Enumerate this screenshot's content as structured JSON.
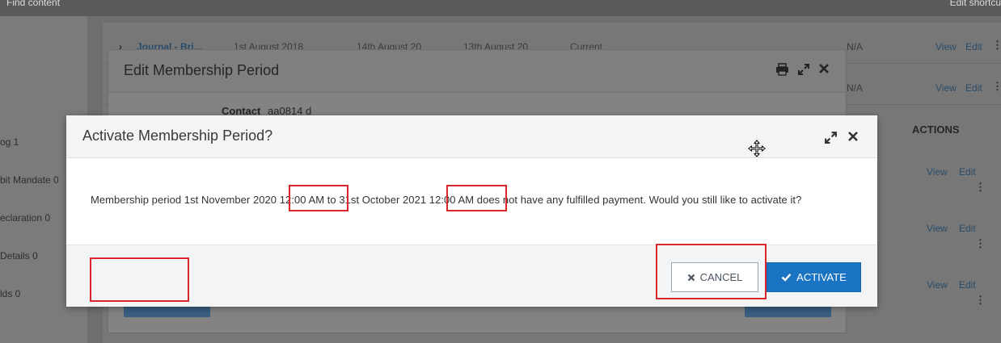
{
  "topbar": {
    "find_content": "Find content",
    "edit_shortcuts": "Edit shortcu"
  },
  "leftnav": {
    "items": [
      "og 1",
      "bit Mandate 0",
      "eclaration 0",
      "Details 0",
      "lds 0"
    ]
  },
  "background_table": {
    "row1": {
      "name": "Journal - Bri...",
      "start": "1st August 2018",
      "end": "14th August 20",
      "expiry": "13th August 20",
      "status": "Current",
      "na": "N/A",
      "view": "View",
      "edit": "Edit"
    },
    "row2": {
      "na": "N/A",
      "view": "View",
      "edit": "Edit"
    },
    "actions_header": "ACTIONS",
    "rows_lower": [
      {
        "view": "View",
        "edit": "Edit"
      },
      {
        "view": "View",
        "edit": "Edit"
      },
      {
        "view": "View",
        "edit": "Edit"
      }
    ]
  },
  "edit_modal": {
    "title": "Edit Membership Period",
    "contact_label": "Contact",
    "contact_value": "aa0814 d",
    "icons": [
      "print-icon",
      "expand-icon",
      "close-icon"
    ]
  },
  "dialog": {
    "title": "Activate Membership Period?",
    "message": "Membership period 1st November 2020 12:00 AM to 31st October 2021 12:00 AM does not have any fulfilled payment. Would you still like to activate it?",
    "cancel_label": "CANCEL",
    "activate_label": "ACTIVATE",
    "icons": [
      "expand-icon",
      "close-icon"
    ]
  },
  "colors": {
    "accent": "#1a73c3",
    "highlight": "#d9262c"
  }
}
